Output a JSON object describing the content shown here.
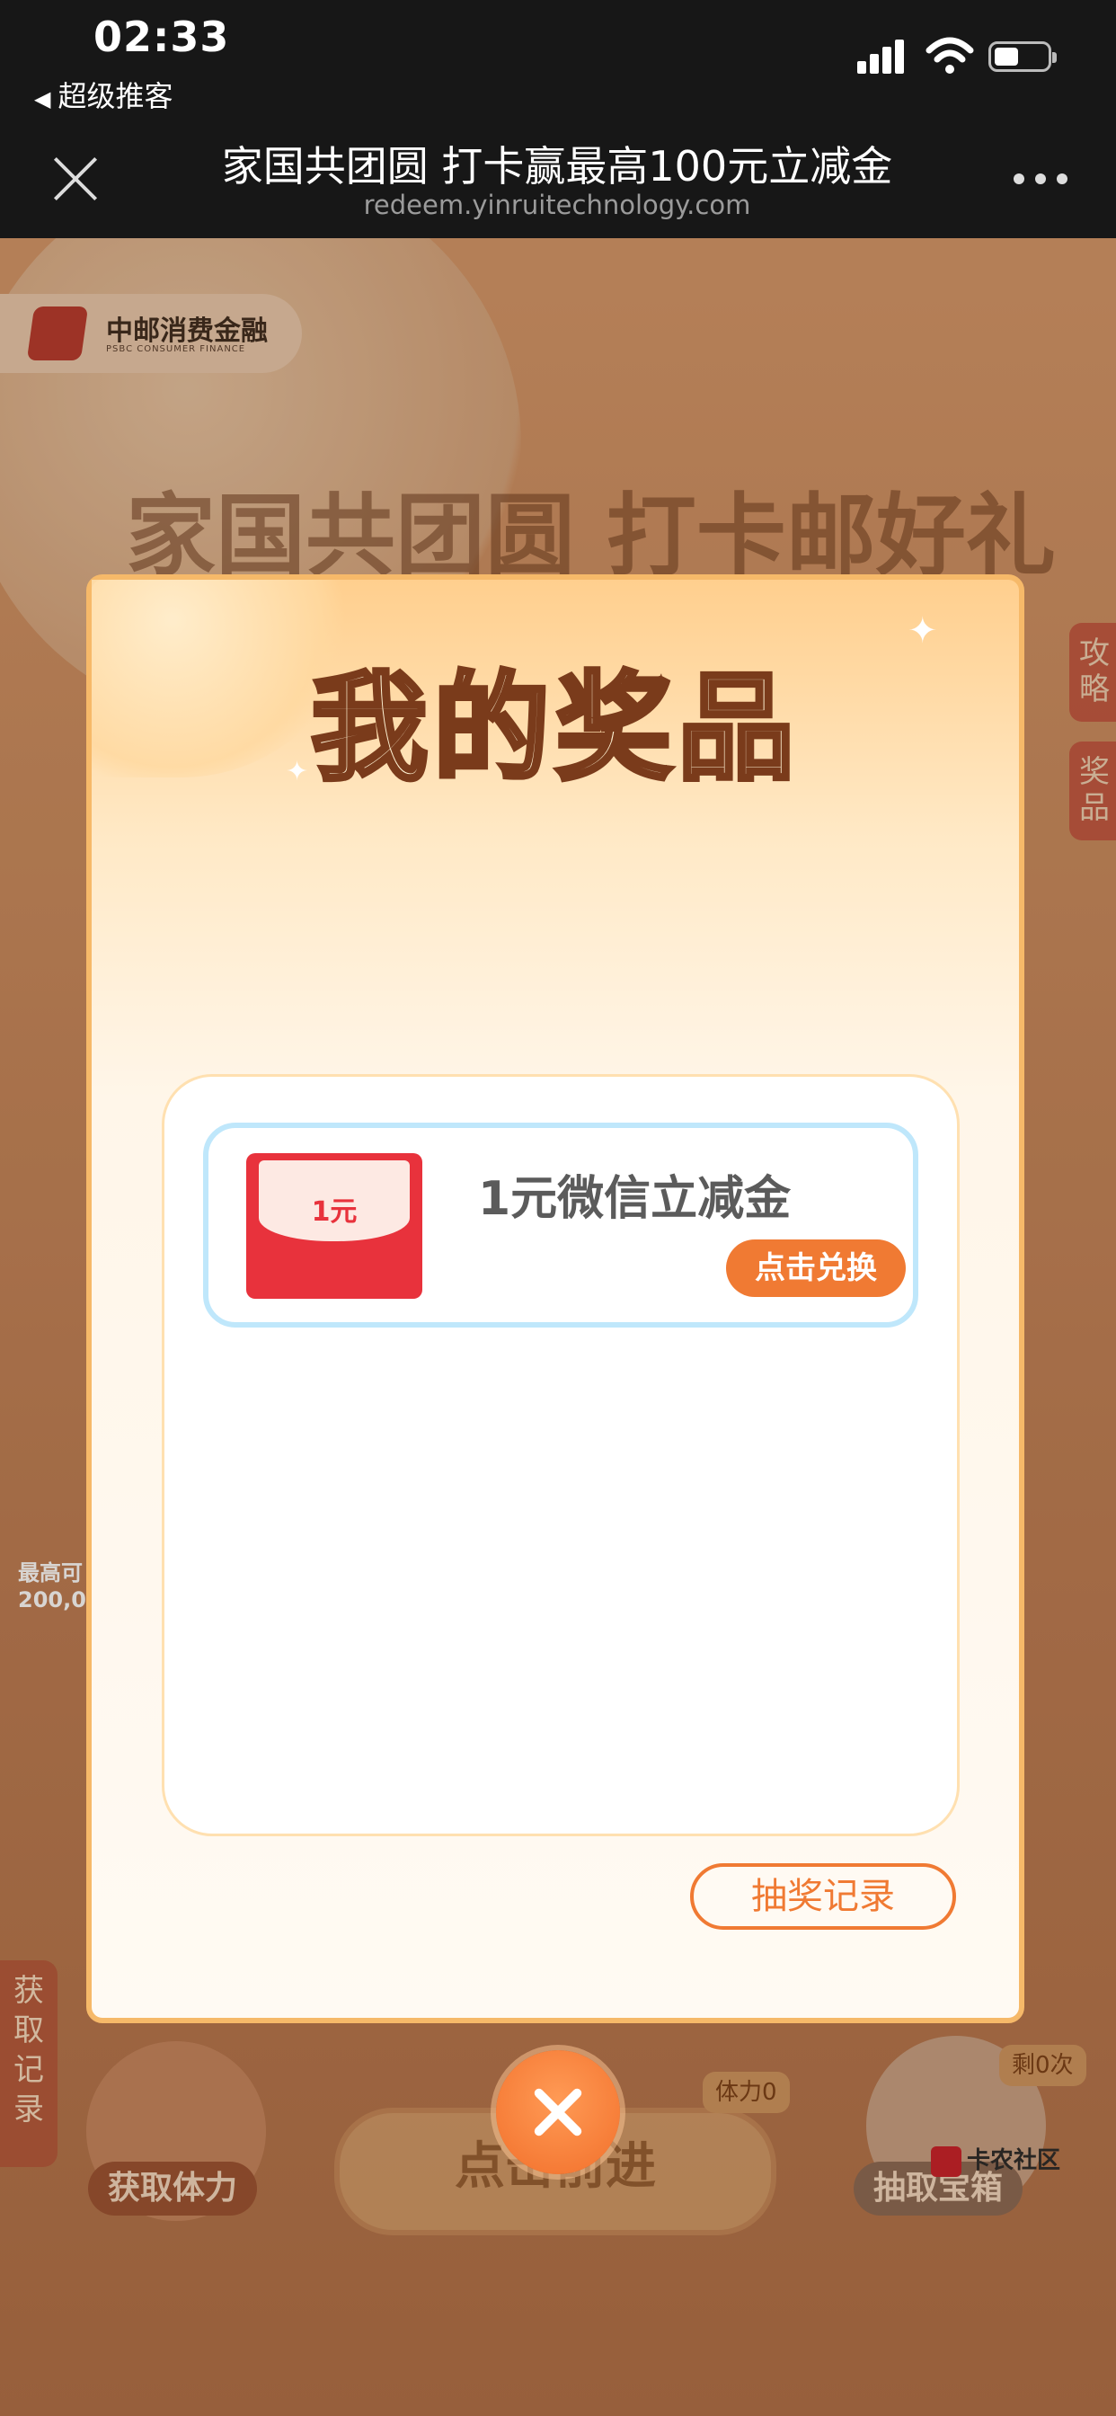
{
  "status_bar": {
    "time": "02:33",
    "back_app": "超级推客"
  },
  "title_bar": {
    "title": "家国共团圆 打卡赢最高100元立减金",
    "url": "redeem.yinruitechnology.com"
  },
  "background": {
    "brand_name": "中邮消费金融",
    "brand_en": "PSBC CONSUMER FINANCE",
    "slogan": "家国共团圆 打卡邮好礼",
    "side_tab_strategy": "攻略",
    "side_tab_prize": "奖品",
    "left_tab": "获取记录",
    "max_amount_line1": "最高可",
    "max_amount_line2": "200,0",
    "get_energy": "获取体力",
    "go_button": "点击前进",
    "energy_hint": "体力0",
    "open_box": "抽取宝箱",
    "remaining_hint": "剩0次",
    "watermark": "卡农社区"
  },
  "modal": {
    "title": "我的奖品",
    "prizes": [
      {
        "envelope_amount": "1元",
        "name": "1元微信立减金",
        "action": "点击兑换"
      }
    ],
    "history_button": "抽奖记录"
  },
  "icons": [
    "close-icon",
    "more-icon",
    "signal-icon",
    "wifi-icon",
    "battery-icon",
    "red-envelope-icon",
    "modal-close-icon"
  ]
}
